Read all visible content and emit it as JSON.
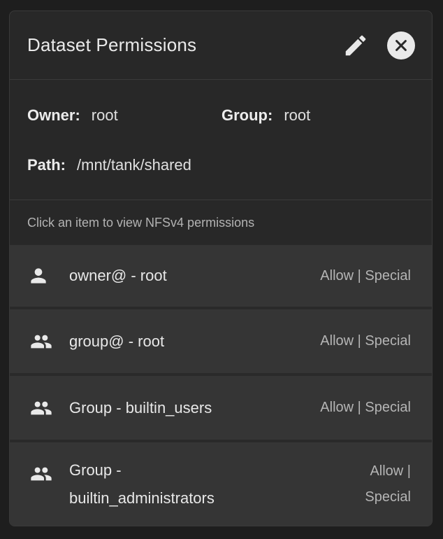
{
  "header": {
    "title": "Dataset Permissions",
    "edit_icon": "pencil-icon",
    "close_icon": "close-icon"
  },
  "info": {
    "owner_label": "Owner:",
    "owner_value": "root",
    "group_label": "Group:",
    "group_value": "root",
    "path_label": "Path:",
    "path_value": "/mnt/tank/shared"
  },
  "hint": "Click an item to view NFSv4 permissions",
  "items": [
    {
      "icon": "person-icon",
      "name": "owner@ - root",
      "perm": "Allow | Special"
    },
    {
      "icon": "people-icon",
      "name": "group@ - root",
      "perm": "Allow | Special"
    },
    {
      "icon": "people-icon",
      "name": "Group - builtin_users",
      "perm": "Allow | Special"
    },
    {
      "icon": "people-icon",
      "name": "Group - builtin_administrators",
      "perm": "Allow | Special"
    }
  ],
  "colors": {
    "background": "#1e1e1e",
    "card": "#282828",
    "item": "#353535",
    "text": "#e6e6e6",
    "muted": "#b5b5b5"
  }
}
